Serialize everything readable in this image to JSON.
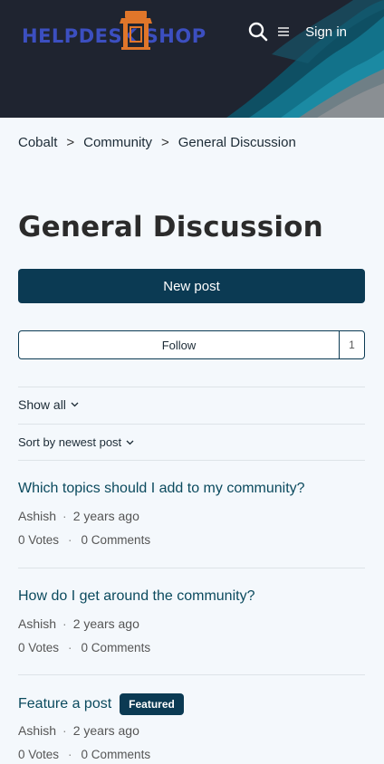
{
  "header": {
    "logo_text": "HELPDESK SHOP",
    "sign_in": "Sign in",
    "icons": [
      "search-icon",
      "menu-icon",
      "shop-icon"
    ],
    "colors": {
      "bg": "#1f2430",
      "wave_dark": "#0e5d70",
      "wave_mid": "#1b8aa3",
      "wave_gray": "#8a8f93",
      "logo": "#3c4fc0",
      "logo_icon": "#e0762a"
    }
  },
  "breadcrumb": {
    "items": [
      "Cobalt",
      "Community",
      "General Discussion"
    ],
    "separator": ">"
  },
  "page": {
    "title": "General Discussion",
    "new_post": "New post",
    "follow": "Follow",
    "follow_count": "1",
    "show_all": "Show all",
    "sort": "Sort by newest post",
    "accent": "#0b3a53"
  },
  "posts": [
    {
      "title": "Which topics should I add to my community?",
      "author": "Ashish",
      "time": "2 years ago",
      "votes": "0 Votes",
      "comments": "0 Comments",
      "badge": ""
    },
    {
      "title": "How do I get around the community?",
      "author": "Ashish",
      "time": "2 years ago",
      "votes": "0 Votes",
      "comments": "0 Comments",
      "badge": ""
    },
    {
      "title": "Feature a post",
      "author": "Ashish",
      "time": "2 years ago",
      "votes": "0 Votes",
      "comments": "0 Comments",
      "badge": "Featured"
    }
  ]
}
